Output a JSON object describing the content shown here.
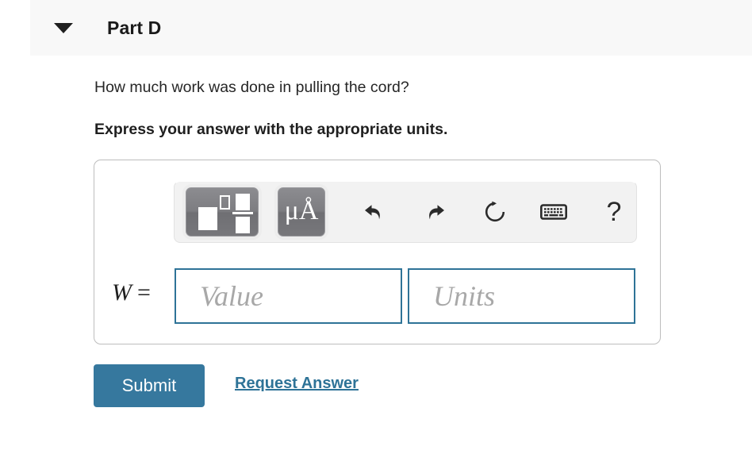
{
  "part": {
    "title": "Part D",
    "collapse_icon": "triangle-down-icon"
  },
  "question": {
    "prompt": "How much work was done in pulling the cord?",
    "instruction": "Express your answer with the appropriate units."
  },
  "toolbar": {
    "template_button_label": "math-template-palette",
    "units_button_label": "μÅ",
    "undo_label": "undo-icon",
    "redo_label": "redo-icon",
    "reset_label": "reset-icon",
    "keyboard_label": "keyboard-icon",
    "help_label": "?"
  },
  "answer": {
    "variable": "W",
    "equals": "=",
    "value_placeholder": "Value",
    "units_placeholder": "Units",
    "value_current": "",
    "units_current": ""
  },
  "actions": {
    "submit_label": "Submit",
    "request_answer_label": "Request Answer"
  },
  "colors": {
    "accent_teal": "#2e7397",
    "submit_teal": "#36789e",
    "header_bg": "#f8f8f8",
    "toolbar_bg": "#f2f2f2",
    "button_grey": "#7d7d81",
    "placeholder_grey": "#a8a8a8"
  }
}
